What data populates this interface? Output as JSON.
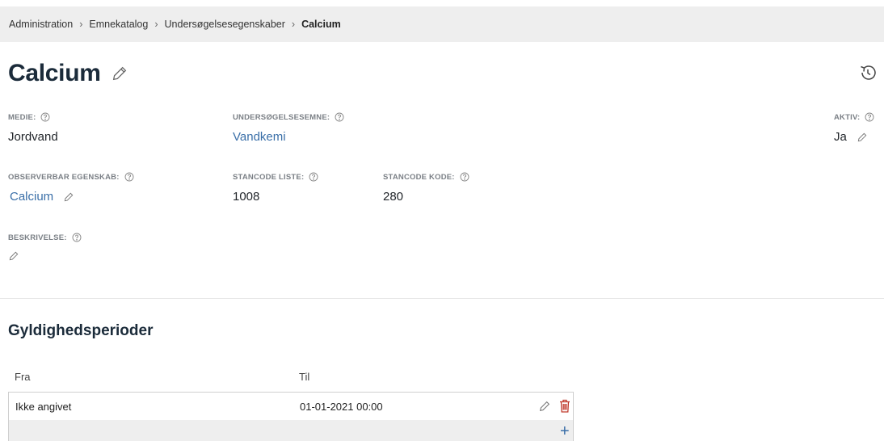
{
  "breadcrumb": {
    "items": [
      "Administration",
      "Emnekatalog",
      "Undersøgelsesegenskaber"
    ],
    "separator": "›",
    "current": "Calcium"
  },
  "page": {
    "title": "Calcium"
  },
  "fields": {
    "medie": {
      "label": "MEDIE:",
      "value": "Jordvand"
    },
    "undersogelsesemne": {
      "label": "UNDERSØGELSESEMNE:",
      "value": "Vandkemi"
    },
    "aktiv": {
      "label": "AKTIV:",
      "value": "Ja"
    },
    "observerbar_egenskab": {
      "label": "OBSERVERBAR EGENSKAB:",
      "value": "Calcium"
    },
    "stancode_liste": {
      "label": "STANCODE LISTE:",
      "value": "1008"
    },
    "stancode_kode": {
      "label": "STANCODE KODE:",
      "value": "280"
    },
    "beskrivelse": {
      "label": "BESKRIVELSE:",
      "value": ""
    }
  },
  "validity": {
    "title": "Gyldighedsperioder",
    "columns": [
      "Fra",
      "Til"
    ],
    "rows": [
      {
        "fra": "Ikke angivet",
        "til": "01-01-2021 00:00"
      }
    ],
    "add_label": "+"
  },
  "icons": {
    "edit": "pencil-icon",
    "help": "help-circle-icon",
    "history": "history-icon",
    "delete": "trash-icon",
    "add": "plus-icon"
  },
  "colors": {
    "link": "#3a6fa8",
    "delete": "#c0392b",
    "breadcrumb_bg": "#eeeeee"
  }
}
